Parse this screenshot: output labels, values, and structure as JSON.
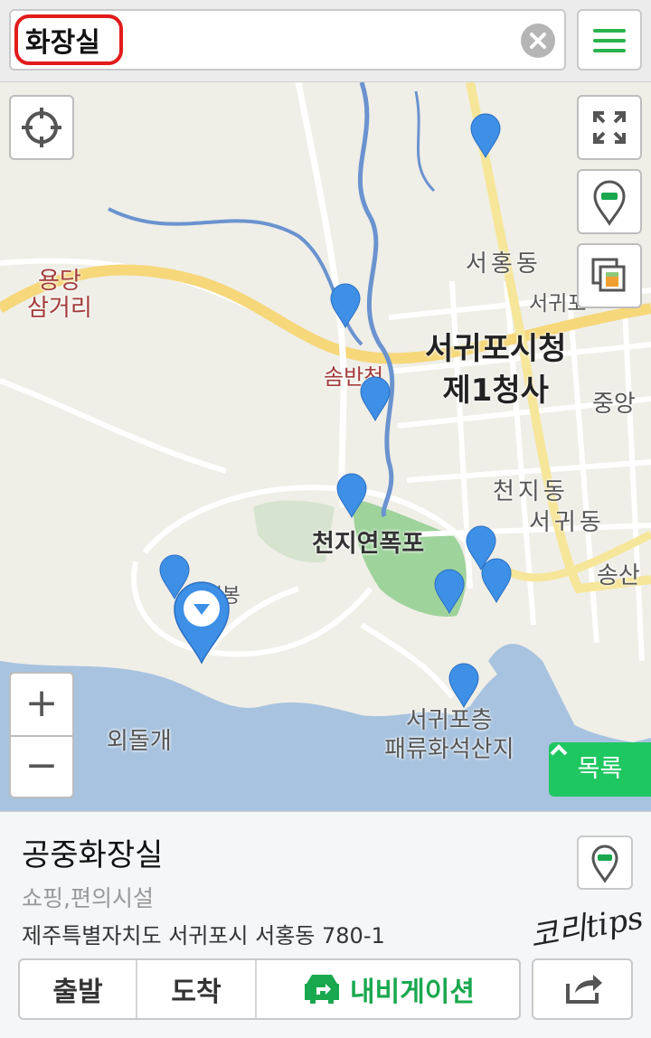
{
  "search": {
    "query": "화장실",
    "clear_icon": "close-circle-icon"
  },
  "menu": {
    "icon": "hamburger-menu-icon",
    "accent": "#2bb24c"
  },
  "map": {
    "labels": {
      "yongdang": "용당\n삼거리",
      "seohong": "서홍동",
      "seogwipo_partial": "서귀포",
      "cityhall": "서귀포시청\n제1청사",
      "jungang": "중앙",
      "sombanchun": "솜반천",
      "cheonji_dong": "천지동",
      "seogwi_dong": "서귀동",
      "cheonjiyeon": "천지연폭포",
      "song_partial": "송산",
      "sammaebong": "삼매봉",
      "oedolgae": "외돌개",
      "fossil": "서귀포층\n패류화석산지"
    },
    "controls": {
      "locate_icon": "crosshair-icon",
      "fullscreen_icon": "expand-icon",
      "marker_icon": "map-pin-icon",
      "layers_icon": "layers-icon",
      "zoom_in": "+",
      "zoom_out": "−"
    },
    "list_button": {
      "label": "목록",
      "icon": "chevron-up-icon",
      "color": "#1fc761"
    },
    "pin_color": "#3e8fe6"
  },
  "place": {
    "name": "공중화장실",
    "category": "쇼핑,편의시설",
    "address": "제주특별자치도 서귀포시 서홍동 780-1"
  },
  "actions": {
    "depart": "출발",
    "arrive": "도착",
    "navigation": "내비게이션",
    "navigation_color": "#1aa84f",
    "share_icon": "share-icon"
  },
  "watermark": "코리tips"
}
